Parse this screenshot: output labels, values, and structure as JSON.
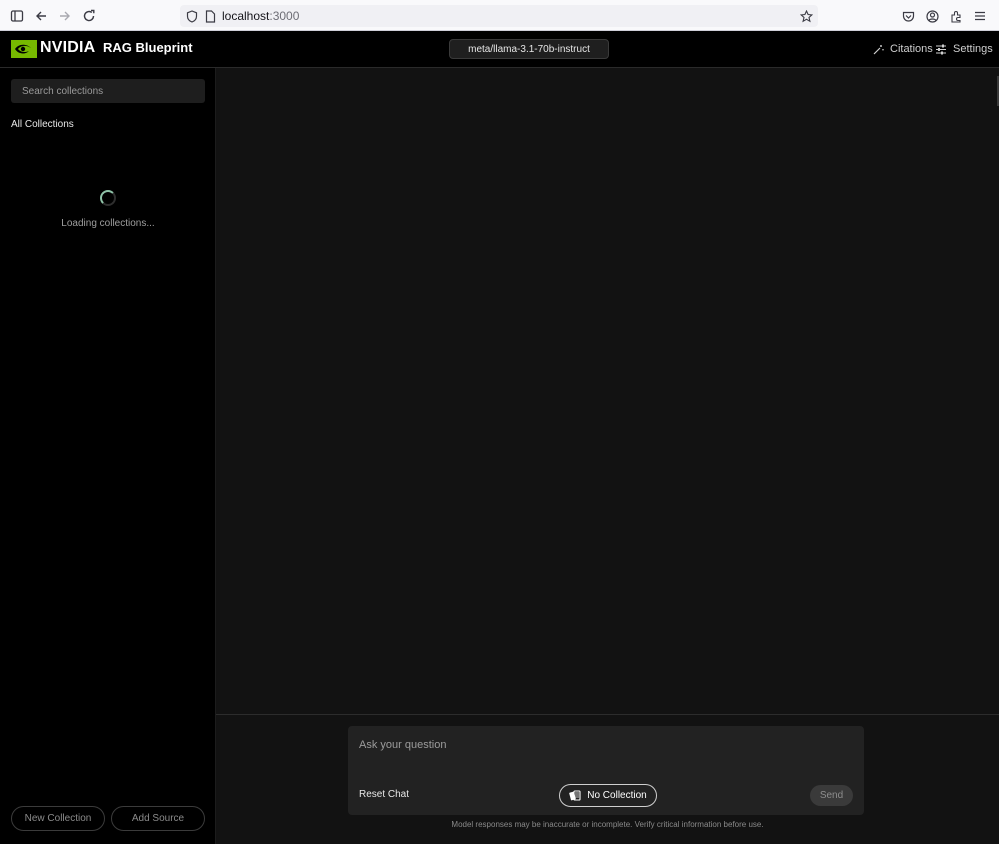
{
  "browser": {
    "url_host": "localhost",
    "url_port": ":3000"
  },
  "header": {
    "brand": "NVIDIA",
    "title": "RAG Blueprint",
    "model": "meta/llama-3.1-70b-instruct",
    "citations_label": "Citations",
    "settings_label": "Settings"
  },
  "sidebar": {
    "search_placeholder": "Search collections",
    "all_collections_label": "All Collections",
    "loading_text": "Loading collections...",
    "new_collection_label": "New Collection",
    "add_source_label": "Add Source"
  },
  "composer": {
    "placeholder": "Ask your question",
    "reset_label": "Reset Chat",
    "collection_label": "No Collection",
    "send_label": "Send"
  },
  "footer": {
    "disclaimer": "Model responses may be inaccurate or incomplete. Verify critical information before use."
  },
  "colors": {
    "brand_green": "#76b900",
    "background": "#000000",
    "panel": "#121212"
  }
}
